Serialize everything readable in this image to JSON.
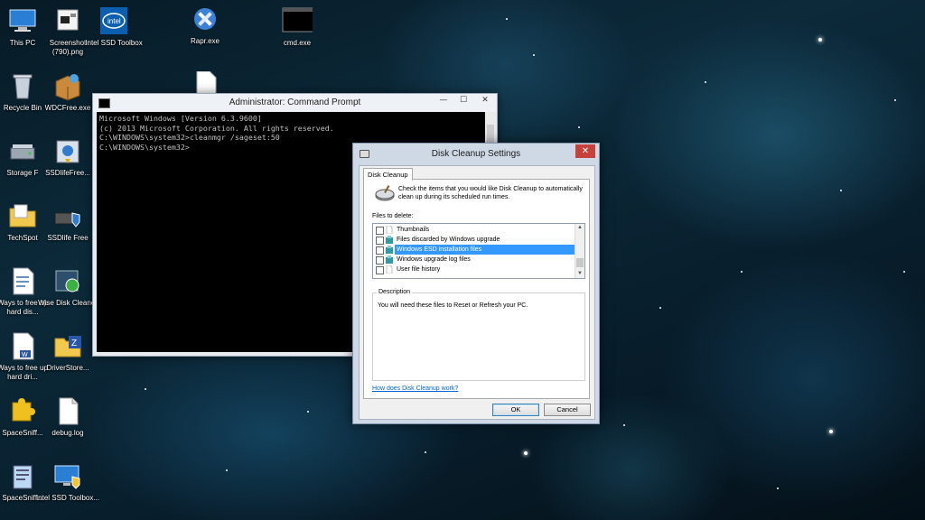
{
  "desktop": {
    "icons": [
      {
        "label": "This PC"
      },
      {
        "label": "Screenshot (790).png"
      },
      {
        "label": "Intel SSD Toolbox"
      },
      {
        "label": "Rapr.exe"
      },
      {
        "label": "cmd.exe"
      },
      {
        "label": "Recycle Bin"
      },
      {
        "label": "WDCFree.exe"
      },
      {
        "label": "Storage F"
      },
      {
        "label": "SSDlifeFree..."
      },
      {
        "label": "TechSpot"
      },
      {
        "label": "SSDlife Free"
      },
      {
        "label": "Ways to free up hard dis..."
      },
      {
        "label": "Wise Disk Cleaner"
      },
      {
        "label": "Ways to free up hard dri..."
      },
      {
        "label": "DriverStore..."
      },
      {
        "label": "SpaceSniff..."
      },
      {
        "label": "debug.log"
      },
      {
        "label": "SpaceSniff..."
      },
      {
        "label": "Intel SSD Toolbox..."
      }
    ]
  },
  "cmd": {
    "title": "Administrator: Command Prompt",
    "lines": [
      "Microsoft Windows [Version 6.3.9600]",
      "(c) 2013 Microsoft Corporation. All rights reserved.",
      "",
      "C:\\WINDOWS\\system32>cleanmgr /sageset:50",
      "",
      "C:\\WINDOWS\\system32>"
    ],
    "controls": {
      "minimize": "—",
      "maximize": "☐",
      "close": "✕"
    }
  },
  "dialog": {
    "title": "Disk Cleanup Settings",
    "close": "✕",
    "tab": "Disk Cleanup",
    "intro": "Check the items that you would like Disk Cleanup to automatically clean up during its scheduled run times.",
    "files_label": "Files to delete:",
    "items": [
      {
        "label": "Thumbnails",
        "checked": false,
        "selected": false
      },
      {
        "label": "Files discarded by Windows upgrade",
        "checked": false,
        "selected": false
      },
      {
        "label": "Windows ESD installation files",
        "checked": false,
        "selected": true
      },
      {
        "label": "Windows upgrade log files",
        "checked": false,
        "selected": false
      },
      {
        "label": "User file history",
        "checked": false,
        "selected": false
      }
    ],
    "description_label": "Description",
    "description": "You will need these files to Reset or Refresh your PC.",
    "help_link": "How does Disk Cleanup work?",
    "ok": "OK",
    "cancel": "Cancel"
  }
}
